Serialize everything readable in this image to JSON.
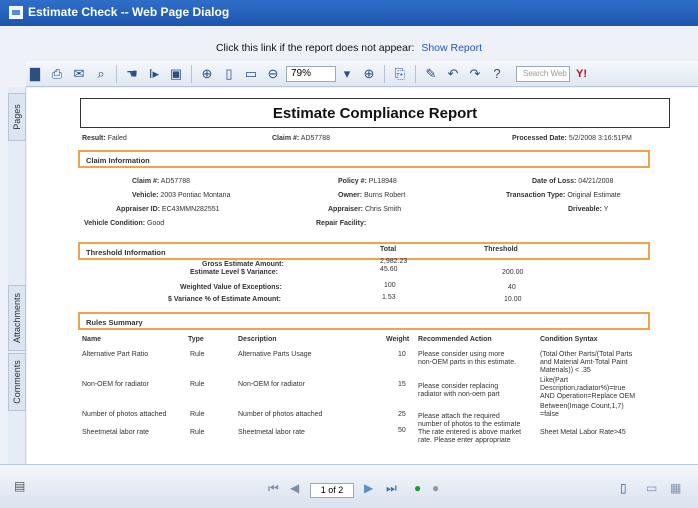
{
  "window": {
    "title": "Estimate Check -- Web Page Dialog"
  },
  "notice": {
    "text": "Click this link if the report does not appear:",
    "link": "Show Report"
  },
  "toolbar": {
    "zoom": "79%",
    "search_placeholder": "Search Web",
    "yahoo": "Y!"
  },
  "side_tabs": {
    "pages": "Pages",
    "attachments": "Attachments",
    "comments": "Comments"
  },
  "report": {
    "title": "Estimate Compliance Report",
    "result_label": "Result:",
    "result_value": "Failed",
    "claim_label": "Claim #:",
    "claim_value": "AD57788",
    "processed_label": "Processed Date:",
    "processed_value": "5/2/2008  3:16:51PM",
    "claim_info": {
      "header": "Claim Information",
      "claim_no_label": "Claim #:",
      "claim_no": "AD57788",
      "vehicle_label": "Vehicle:",
      "vehicle": "2003 Pontiac Montana",
      "appraiser_id_label": "Appraiser ID:",
      "appraiser_id": "EC43MMN282551",
      "vehicle_condition_label": "Vehicle Condition:",
      "vehicle_condition": "Good",
      "policy_label": "Policy #:",
      "policy": "PL18948",
      "owner_label": "Owner:",
      "owner": "Burns Robert",
      "appraiser_label": "Appraiser:",
      "appraiser": "Chris Smith",
      "repair_facility_label": "Repair Facility:",
      "loss_date_label": "Date of Loss:",
      "loss_date": "04/21/2008",
      "transaction_label": "Transaction Type:",
      "transaction": "Original Estimate",
      "driveable_label": "Driveable:",
      "driveable": "Y"
    },
    "threshold": {
      "header": "Threshold Information",
      "col_total": "Total",
      "col_threshold": "Threshold",
      "rows": [
        {
          "label": "Gross Estimate Amount:",
          "total": "2,982.23",
          "threshold": ""
        },
        {
          "label": "Estimate Level $ Variance:",
          "total": "45.60",
          "threshold": "200.00"
        },
        {
          "label": "Weighted Value of Exceptions:",
          "total": "100",
          "threshold": "40"
        },
        {
          "label": "$ Variance % of Estimate Amount:",
          "total": "1.53",
          "threshold": "10.00"
        }
      ]
    },
    "rules": {
      "header": "Rules Summary",
      "columns": [
        "Name",
        "Type",
        "Description",
        "Weight",
        "Recommended Action",
        "Condition Syntax"
      ],
      "rows": [
        {
          "name": "Alternative Part Ratio",
          "type": "Rule",
          "description": "Alternative Parts Usage",
          "weight": "10",
          "action": [
            "Please consider using more",
            "non-OEM parts in this estimate."
          ],
          "condition": [
            "(Total Other Parts/(Total Parts",
            "and Material Amt-Total Paint",
            "Materials)) < .35"
          ]
        },
        {
          "name": "Non-OEM for radiator",
          "type": "Rule",
          "description": "Non-OEM for radiator",
          "weight": "15",
          "action": [
            "Please consider replacing",
            "radiator with non-oem part"
          ],
          "condition": [
            "Like(Part",
            "Description,radiator%)=true",
            "AND Operation=Replace OEM"
          ]
        },
        {
          "name": "Number of photos attached",
          "type": "Rule",
          "description": "Number of photos attached",
          "weight": "25",
          "action": [
            "Please attach the required",
            "number of photos to the estimate"
          ],
          "condition": [
            "Between(Image Count,1,7)",
            "=false"
          ]
        },
        {
          "name": "Sheetmetal labor rate",
          "type": "Rule",
          "description": "Sheetmetal labor rate",
          "weight": "50",
          "action": [
            "The rate entered is above market",
            "rate. Please enter appropriate"
          ],
          "condition": [
            "Sheet Metal Labor Rate>45"
          ]
        }
      ]
    }
  },
  "pager": {
    "value": "1 of 2"
  }
}
